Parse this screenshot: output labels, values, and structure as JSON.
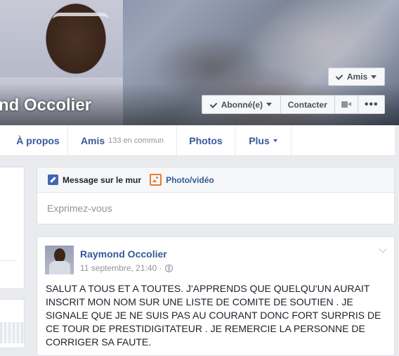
{
  "profile": {
    "name": "nd Occolier"
  },
  "cover_buttons": {
    "friends": "Amis",
    "subscribed": "Abonné(e)",
    "contact": "Contacter",
    "more": "•••"
  },
  "nav": {
    "about": "À propos",
    "friends": "Amis",
    "friends_common": "133 en commun",
    "photos": "Photos",
    "more": "Plus"
  },
  "composer": {
    "wall_post": "Message sur le mur",
    "photo_video": "Photo/vidéo",
    "placeholder": "Exprimez-vous"
  },
  "post": {
    "author": "Raymond Occolier",
    "timestamp": "11 septembre, 21:40 ·",
    "text": "SALUT A TOUS ET A TOUTES. J'APPRENDS QUE QUELQU'UN AURAIT INSCRIT MON NOM SUR UNE LISTE DE COMITE DE SOUTIEN . JE SIGNALE QUE JE NE SUIS PAS AU COURANT DONC FORT SURPRIS DE CE TOUR DE PRESTIDIGITATEUR . JE REMERCIE LA PERSONNE DE CORRIGER SA FAUTE."
  },
  "colors": {
    "link": "#365899",
    "brand_blue": "#4267b2",
    "photo_orange": "#e87c2d",
    "page_bg": "#e9ebee"
  }
}
